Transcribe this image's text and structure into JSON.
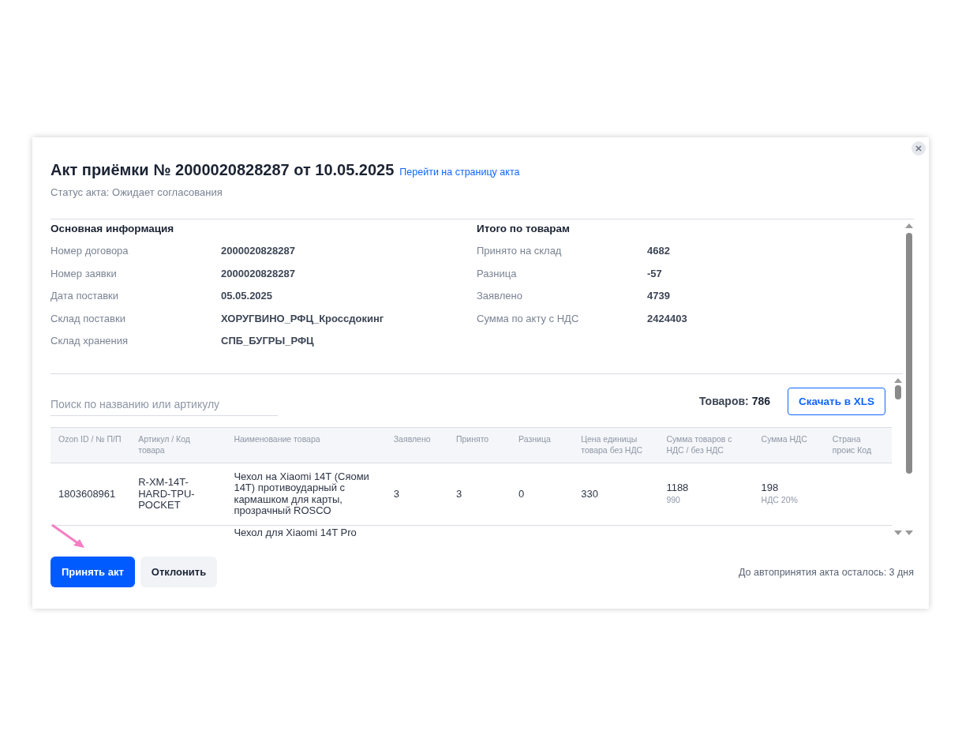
{
  "dialog": {
    "title": "Акт приёмки № 2000020828287 от 10.05.2025",
    "title_link": "Перейти на страницу акта",
    "status": "Статус акта: Ожидает согласования"
  },
  "main_info": {
    "heading": "Основная информация",
    "fields": [
      {
        "label": "Номер договора",
        "value": "2000020828287"
      },
      {
        "label": "Номер заявки",
        "value": "2000020828287"
      },
      {
        "label": "Дата поставки",
        "value": "05.05.2025"
      },
      {
        "label": "Склад поставки",
        "value": "ХОРУГВИНО_РФЦ_Кроссдокинг"
      },
      {
        "label": "Склад хранения",
        "value": "СПБ_БУГРЫ_РФЦ"
      }
    ]
  },
  "totals": {
    "heading": "Итого по товарам",
    "fields": [
      {
        "label": "Принято на склад",
        "value": "4682"
      },
      {
        "label": "Разница",
        "value": "-57"
      },
      {
        "label": "Заявлено",
        "value": "4739"
      },
      {
        "label": "Сумма по акту с НДС",
        "value": "2424403"
      }
    ]
  },
  "search": {
    "placeholder": "Поиск по названию или артикулу"
  },
  "count": {
    "label": "Товаров:",
    "value": "786"
  },
  "download_button": "Скачать в XLS",
  "table": {
    "columns": [
      "Ozon ID / № П/П",
      "Артикул / Код товара",
      "Наименование товара",
      "Заявлено",
      "Принято",
      "Разница",
      "Цена единицы товара без НДС",
      "Сумма товаров с НДС / без НДС",
      "Сумма НДС",
      "Страна проис Код"
    ],
    "rows": [
      {
        "id": "1803608961",
        "article": "R-XM-14T-HARD-TPU-POCKET",
        "name": "Чехол на Xiaomi 14T (Сяоми 14T) противоударный с кармашком для карты, прозрачный ROSCO",
        "declared": "3",
        "accepted": "3",
        "diff": "0",
        "price": "330",
        "sum": "1188",
        "sum_sub": "990",
        "vat": "198",
        "vat_sub": "НДС 20%"
      },
      {
        "name": "Чехол для Xiaomi 14T Pro"
      }
    ]
  },
  "footer": {
    "accept_button": "Принять акт",
    "reject_button": "Отклонить",
    "note": "До автопринятия акта осталось: 3 дня"
  }
}
